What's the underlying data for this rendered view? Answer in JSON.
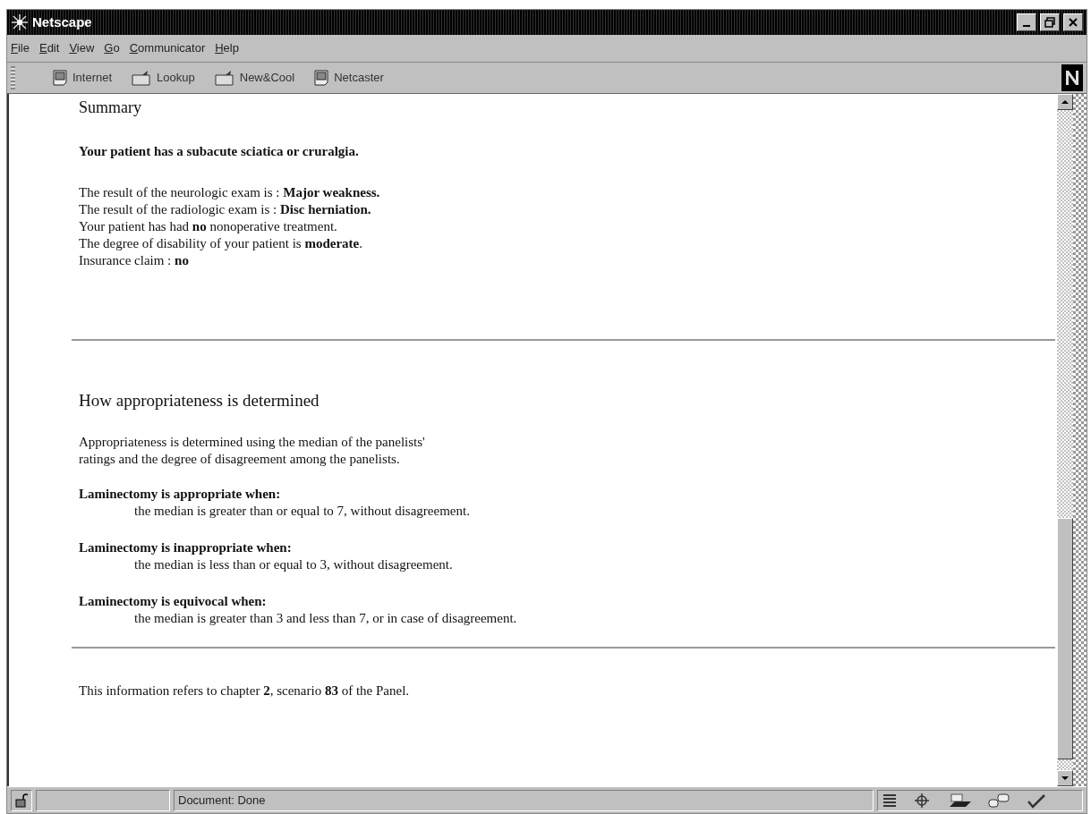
{
  "window": {
    "title": "Netscape"
  },
  "menu": [
    "File",
    "Edit",
    "View",
    "Go",
    "Communicator",
    "Help"
  ],
  "personal_toolbar": [
    {
      "label": "Internet",
      "kind": "page"
    },
    {
      "label": "Lookup",
      "kind": "folder"
    },
    {
      "label": "New&Cool",
      "kind": "folder"
    },
    {
      "label": "Netcaster",
      "kind": "page"
    }
  ],
  "content": {
    "summary": {
      "heading": "Summary",
      "diagnosis": "Your patient has a subacute sciatica or cruralgia.",
      "lines": [
        "The result of the neurologic exam is : **Major weakness.**",
        "The result of the radiologic exam is : **Disc herniation.**",
        "Your patient has had **no** nonoperative treatment.",
        "The degree of disability of your patient is **moderate**.",
        "Insurance claim : **no**"
      ]
    },
    "method": {
      "heading": "How appropriateness is determined",
      "intro": [
        "Appropriateness is determined using the median of the panelists'",
        "ratings and the degree of disagreement among the panelists."
      ],
      "rules": [
        {
          "title": "Laminectomy is appropriate when:",
          "text": "the median is greater than or equal to 7, without disagreement."
        },
        {
          "title": "Laminectomy is inappropriate when:",
          "text": "the median is less than or equal to 3, without disagreement."
        },
        {
          "title": "Laminectomy is equivocal when:",
          "text": "the median is greater than 3 and less than 7, or in case of disagreement."
        }
      ]
    },
    "footer": "This information refers to chapter **2**, scenario **83** of the Panel."
  },
  "status_bar": {
    "text": "Document: Done"
  }
}
